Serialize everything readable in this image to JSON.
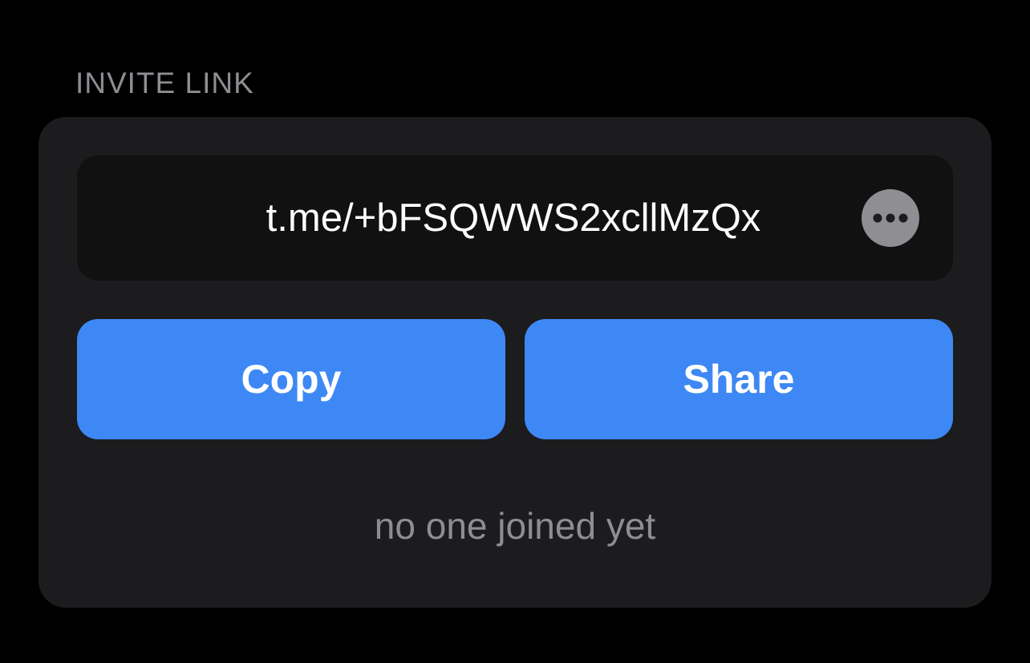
{
  "section": {
    "title": "INVITE LINK"
  },
  "invite": {
    "link": "t.me/+bFSQWWS2xcllMzQx",
    "more_icon": "ellipsis-circle-icon"
  },
  "actions": {
    "copy_label": "Copy",
    "share_label": "Share"
  },
  "status": {
    "joined_text": "no one joined yet"
  },
  "colors": {
    "background": "#000000",
    "card": "#1c1c1e",
    "field": "#111111",
    "accent": "#3e88f5",
    "secondary_text": "#8d8d93"
  }
}
